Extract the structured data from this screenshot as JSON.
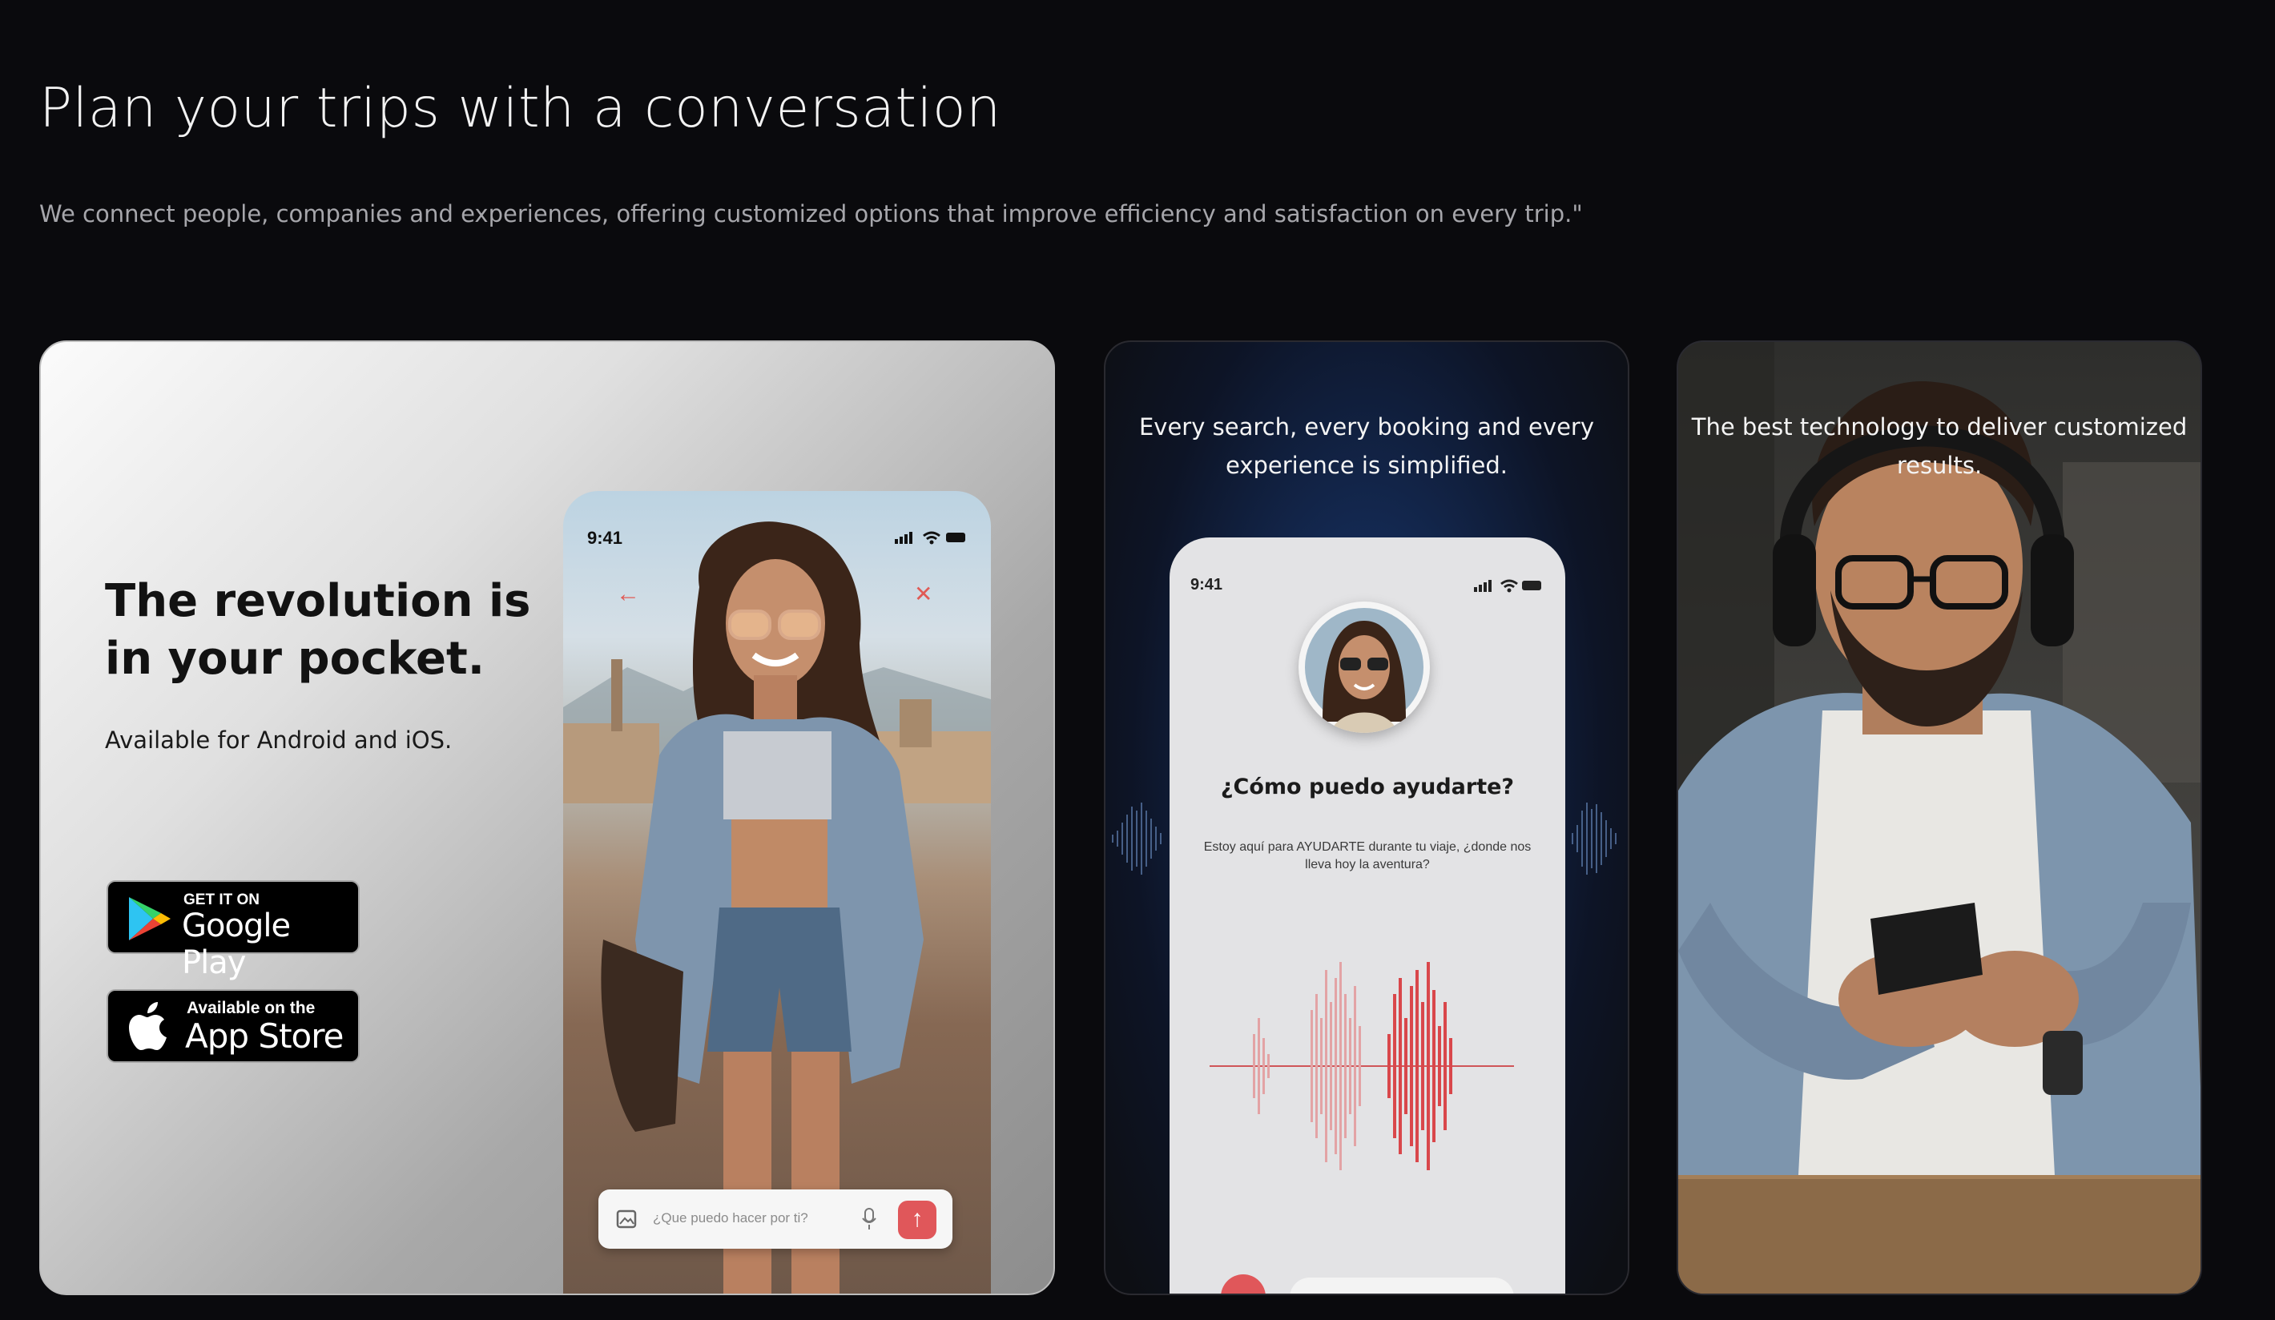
{
  "header": {
    "title": "Plan your trips with a conversation",
    "subtitle": "We connect people, companies and experiences, offering customized options that improve efficiency and satisfaction on every trip.\""
  },
  "card_app": {
    "headline": "The revolution is in your pocket.",
    "availability": "Available for Android and iOS.",
    "google_play": {
      "small": "GET IT ON",
      "big": "Google Play"
    },
    "app_store": {
      "small": "Available on the",
      "big": "App Store"
    },
    "phone": {
      "time": "9:41",
      "chat_placeholder": "¿Que puedo hacer por ti?"
    }
  },
  "card_voice": {
    "caption": "Every search, every booking and every experience is simplified.",
    "phone": {
      "time": "9:41",
      "question": "¿Cómo puedo ayudarte?",
      "description": "Estoy aquí para AYUDARTE durante tu viaje, ¿donde nos lleva hoy la aventura?"
    }
  },
  "card_tech": {
    "caption": "The best technology to deliver customized results."
  },
  "colors": {
    "background": "#0a0a0d",
    "accent_red": "#e0575a",
    "card_blue_glow": "#1e3a6e"
  }
}
